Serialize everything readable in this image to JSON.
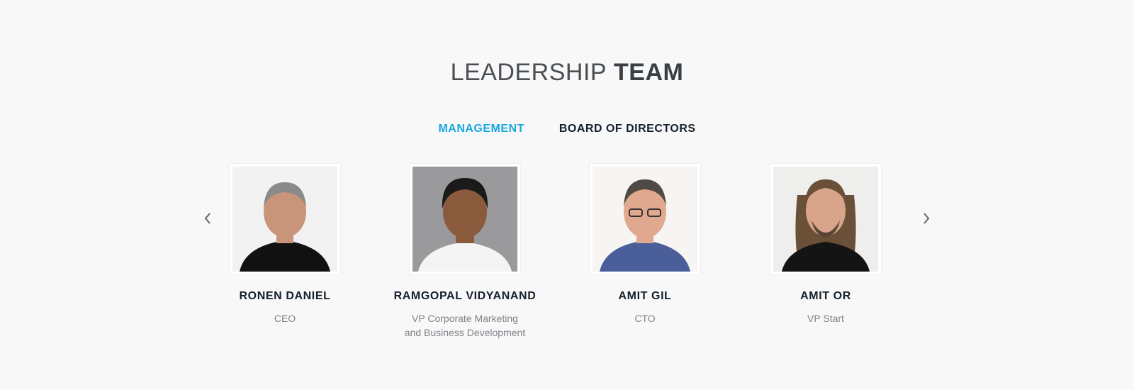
{
  "section": {
    "title_light": "LEADERSHIP",
    "title_bold": "TEAM"
  },
  "tabs": [
    {
      "label": "MANAGEMENT",
      "active": true
    },
    {
      "label": "BOARD OF DIRECTORS",
      "active": false
    }
  ],
  "carousel": {
    "prev_icon": "chevron-left-icon",
    "next_icon": "chevron-right-icon",
    "members": [
      {
        "name": "RONEN DANIEL",
        "role": "CEO",
        "photo_bg": "#f2f2f2",
        "shirt": "#111111",
        "hair": "#8a8a8a",
        "skin": "#c9957a"
      },
      {
        "name": "RAMGOPAL VIDYANAND",
        "role": "VP Corporate Marketing\nand Business Development",
        "photo_bg": "#9a9a9c",
        "shirt": "#f4f4f4",
        "hair": "#1a1a1a",
        "skin": "#8a5a3c"
      },
      {
        "name": "AMIT GIL",
        "role": "CTO",
        "photo_bg": "#f6f5f3",
        "shirt": "#4a5f9a",
        "hair": "#4f4a45",
        "skin": "#e0a98f"
      },
      {
        "name": "AMIT OR",
        "role": "VP Start",
        "photo_bg": "#eeeeec",
        "shirt": "#141414",
        "hair": "#6b5038",
        "skin": "#d8a58a"
      }
    ]
  },
  "colors": {
    "accent": "#18a6df",
    "text_dark": "#15202c",
    "text_muted": "#7d8288",
    "background": "#f8f8f8"
  }
}
